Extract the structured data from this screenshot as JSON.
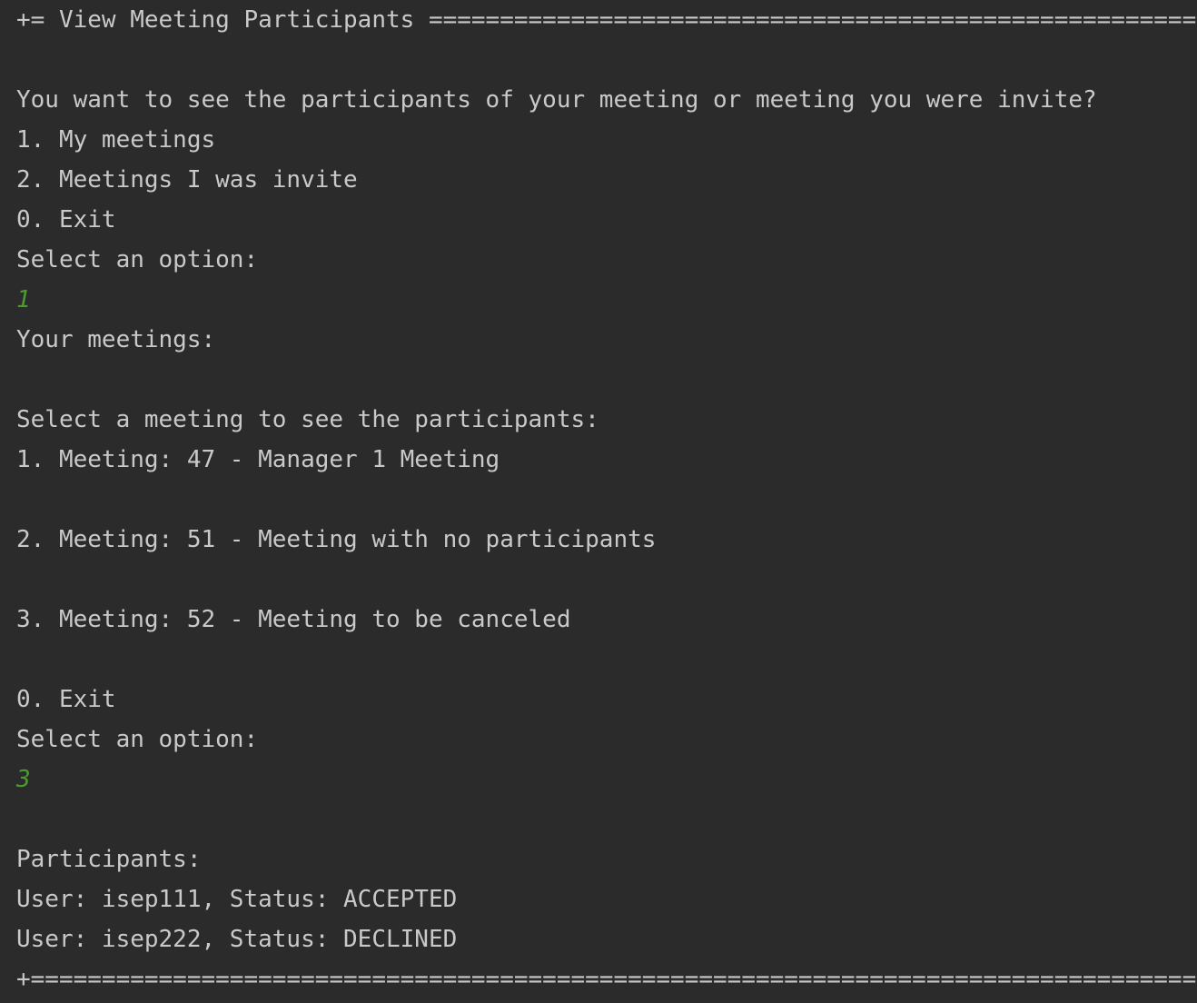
{
  "console": {
    "header_rule": "+= View Meeting Participants =========================================================+",
    "prompt_question": "You want to see the participants of your meeting or meeting you were invite?",
    "main_menu": [
      "1. My meetings",
      "2. Meetings I was invite",
      "0. Exit"
    ],
    "select_prompt_1": "Select an option:",
    "user_input_1": "1",
    "your_meetings_label": "Your meetings:",
    "select_meeting_prompt": "Select a meeting to see the participants:",
    "meetings": [
      "1. Meeting: 47 - Manager 1 Meeting",
      "2. Meeting: 51 - Meeting with no participants",
      "3. Meeting: 52 - Meeting to be canceled"
    ],
    "meetings_exit": "0. Exit",
    "select_prompt_2": "Select an option:",
    "user_input_2": "3",
    "participants_label": "Participants:",
    "participants": [
      "User: isep111, Status: ACCEPTED",
      "User: isep222, Status: DECLINED"
    ],
    "footer_rule": "+====================================================================================+"
  },
  "colors": {
    "background": "#2b2b2b",
    "text": "#c9c9c9",
    "user_input": "#4d9b2e"
  }
}
